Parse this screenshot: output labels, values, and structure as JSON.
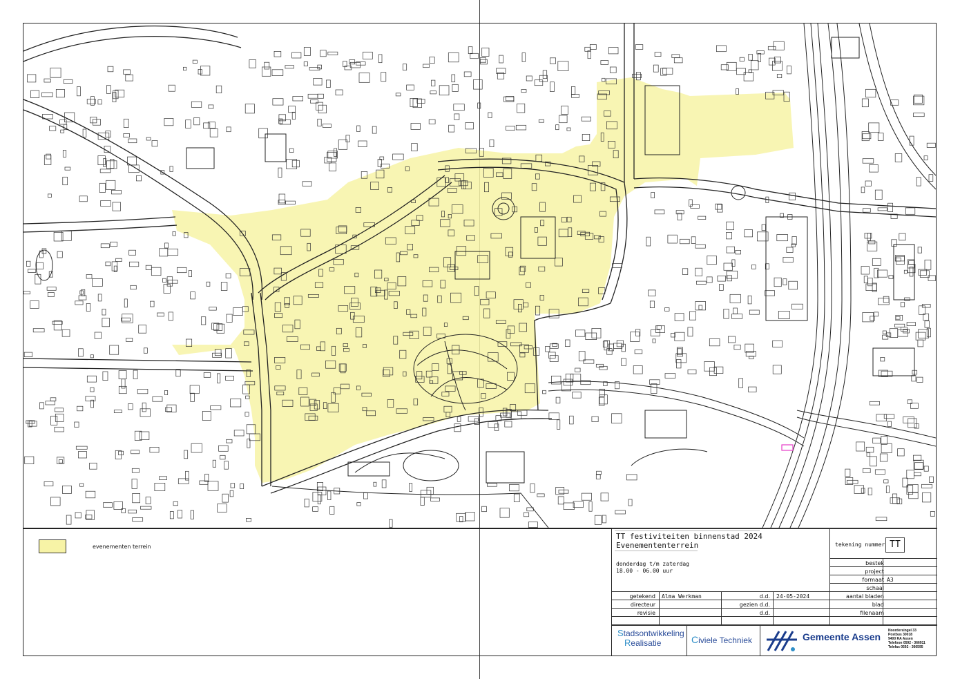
{
  "legend": {
    "label": "evenementen terrein",
    "swatch_color": "#f7f3a6"
  },
  "title_block": {
    "title_line1": "TT festiviteiten binnenstad 2024",
    "title_line2": "Evenemententerrein",
    "schedule_line1": "donderdag t/m zaterdag",
    "schedule_line2": "18.00 - 06.00 uur",
    "drawing_number_label": "tekening nummer",
    "drawing_number": "TT",
    "fields": {
      "bestek": "bestek",
      "project": "project",
      "formaat": "formaat",
      "formaat_value": "A3",
      "schaal": "schaal",
      "aantal_bladen": "aantal bladen",
      "blad": "blad",
      "filenaam": "filenaam"
    },
    "getekend_label": "getekend",
    "getekend_value": "Alma Werkman",
    "date_label": "d.d.",
    "date_value": "24-05-2024",
    "directeur_label": "directeur",
    "gezien_label": "gezien d.d.",
    "revisie_label": "revisie",
    "revisie_date_label": "d.d."
  },
  "logos": {
    "sor_line1": "tadsontwikkeling",
    "sor_line1_initial": "S",
    "sor_line2": "ealisatie",
    "sor_line2_initial": "R",
    "ct_initial": "C",
    "ct_text": "iviele Techniek",
    "municipality": "Gemeente Assen",
    "address": [
      "Noordersingel 33",
      "Postbus 30018",
      "9400 RA Assen",
      "Telefoon 0592 - 366911",
      "Telefax 0592 - 366595"
    ]
  },
  "map": {
    "highlight_color": "#f7f3a6",
    "line_color": "#333333"
  }
}
